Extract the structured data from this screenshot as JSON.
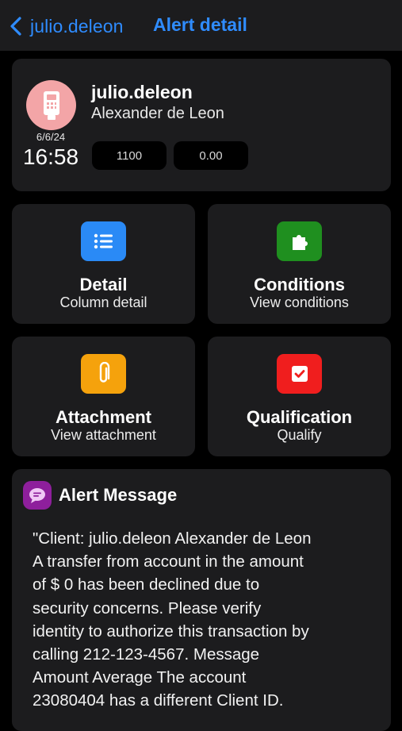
{
  "nav": {
    "back_label": "julio.deleon",
    "title": "Alert detail",
    "accent_color": "#2f8cff"
  },
  "profile": {
    "username": "julio.deleon",
    "full_name": "Alexander de Leon",
    "date": "6/6/24",
    "time": "16:58",
    "avatar_icon": "payment-terminal-icon",
    "avatar_color": "#f3a5a7",
    "values": [
      "1100",
      "0.00"
    ]
  },
  "tiles": [
    {
      "title": "Detail",
      "subtitle": "Column detail",
      "icon": "list-icon",
      "color": "#2a8af6"
    },
    {
      "title": "Conditions",
      "subtitle": "View conditions",
      "icon": "puzzle-icon",
      "color": "#1f8f1f"
    },
    {
      "title": "Attachment",
      "subtitle": "View attachment",
      "icon": "paperclip-icon",
      "color": "#f5a20c"
    },
    {
      "title": "Qualification",
      "subtitle": "Qualify",
      "icon": "checkbox-icon",
      "color": "#f01e1e"
    }
  ],
  "message": {
    "title": "Alert Message",
    "icon": "chat-bubble-icon",
    "icon_color": "#8e1f9c",
    "body": "\"Client: julio.deleon Alexander de Leon\nA transfer from account  in the amount\nof $ 0   has been declined due to\nsecurity concerns. Please verify\nidentity to authorize this transaction by\ncalling 212-123-4567. Message\nAmount Average The account\n23080404 has a different Client ID."
  }
}
